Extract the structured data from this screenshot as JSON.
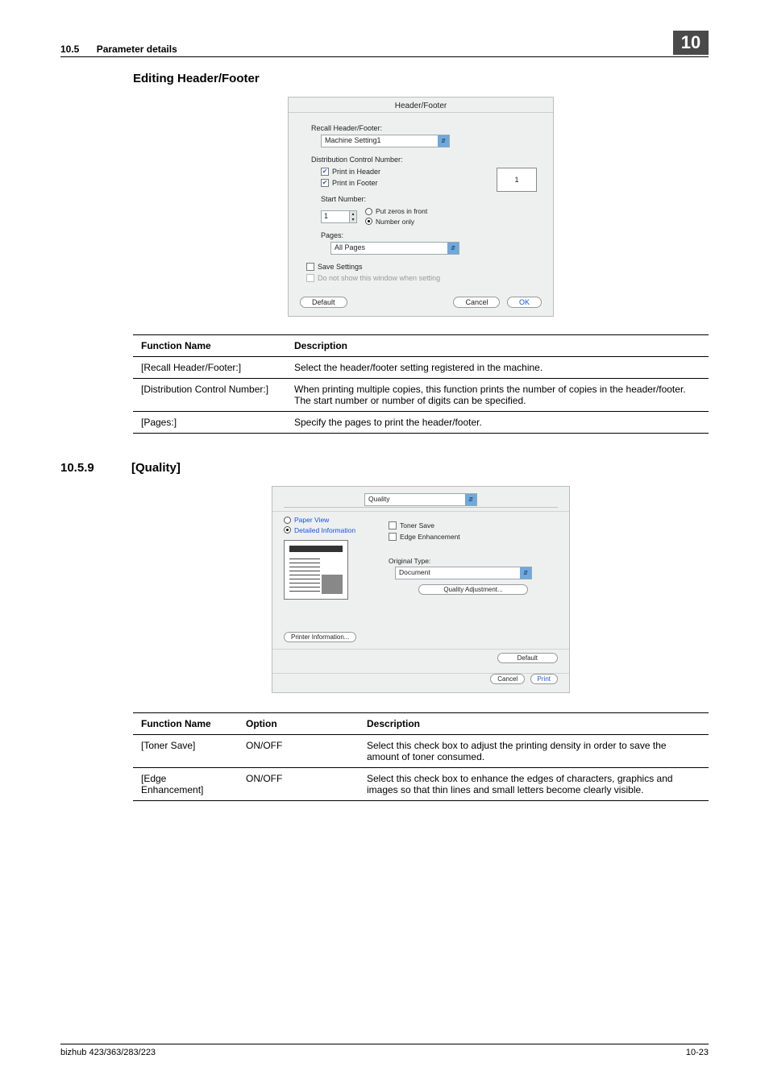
{
  "header": {
    "section_number": "10.5",
    "section_title": "Parameter details",
    "chapter_number": "10"
  },
  "h1": "Editing Header/Footer",
  "dialog1": {
    "title": "Header/Footer",
    "recall_label": "Recall Header/Footer:",
    "recall_value": "Machine Setting1",
    "dcn_label": "Distribution Control Number:",
    "print_header": "Print in Header",
    "print_footer": "Print in Footer",
    "preview_value": "1",
    "start_number_label": "Start Number:",
    "start_number_value": "1",
    "put_zeros": "Put zeros in front",
    "number_only": "Number only",
    "pages_label": "Pages:",
    "pages_value": "All Pages",
    "save_settings": "Save Settings",
    "do_not_show": "Do not show this window when setting",
    "default_btn": "Default",
    "cancel_btn": "Cancel",
    "ok_btn": "OK"
  },
  "table1": {
    "head_fn": "Function Name",
    "head_desc": "Description",
    "rows": [
      {
        "fn": "[Recall Header/Footer:]",
        "desc": "Select the header/footer setting registered in the machine."
      },
      {
        "fn": "[Distribution Control Number:]",
        "desc": "When printing multiple copies, this function prints the number of copies in the header/footer. The start number or number of digits can be specified."
      },
      {
        "fn": "[Pages:]",
        "desc": "Specify the pages to print the header/footer."
      }
    ]
  },
  "sub": {
    "num": "10.5.9",
    "title": "[Quality]"
  },
  "dialog2": {
    "tab": "Quality",
    "paper_view": "Paper View",
    "detailed_info": "Detailed Information",
    "toner_save": "Toner Save",
    "edge_enh": "Edge Enhancement",
    "orig_type_label": "Original Type:",
    "orig_type_value": "Document",
    "quality_adj": "Quality Adjustment...",
    "printer_info": "Printer Information...",
    "default_btn": "Default",
    "cancel_btn": "Cancel",
    "print_btn": "Print"
  },
  "table2": {
    "head_fn": "Function Name",
    "head_opt": "Option",
    "head_desc": "Description",
    "rows": [
      {
        "fn": "[Toner Save]",
        "opt": "ON/OFF",
        "desc": "Select this check box to adjust the printing density in order to save the amount of toner consumed."
      },
      {
        "fn": "[Edge Enhancement]",
        "opt": "ON/OFF",
        "desc": "Select this check box to enhance the edges of characters, graphics and images so that thin lines and small letters become clearly visible."
      }
    ]
  },
  "footer": {
    "left": "bizhub 423/363/283/223",
    "right": "10-23"
  }
}
